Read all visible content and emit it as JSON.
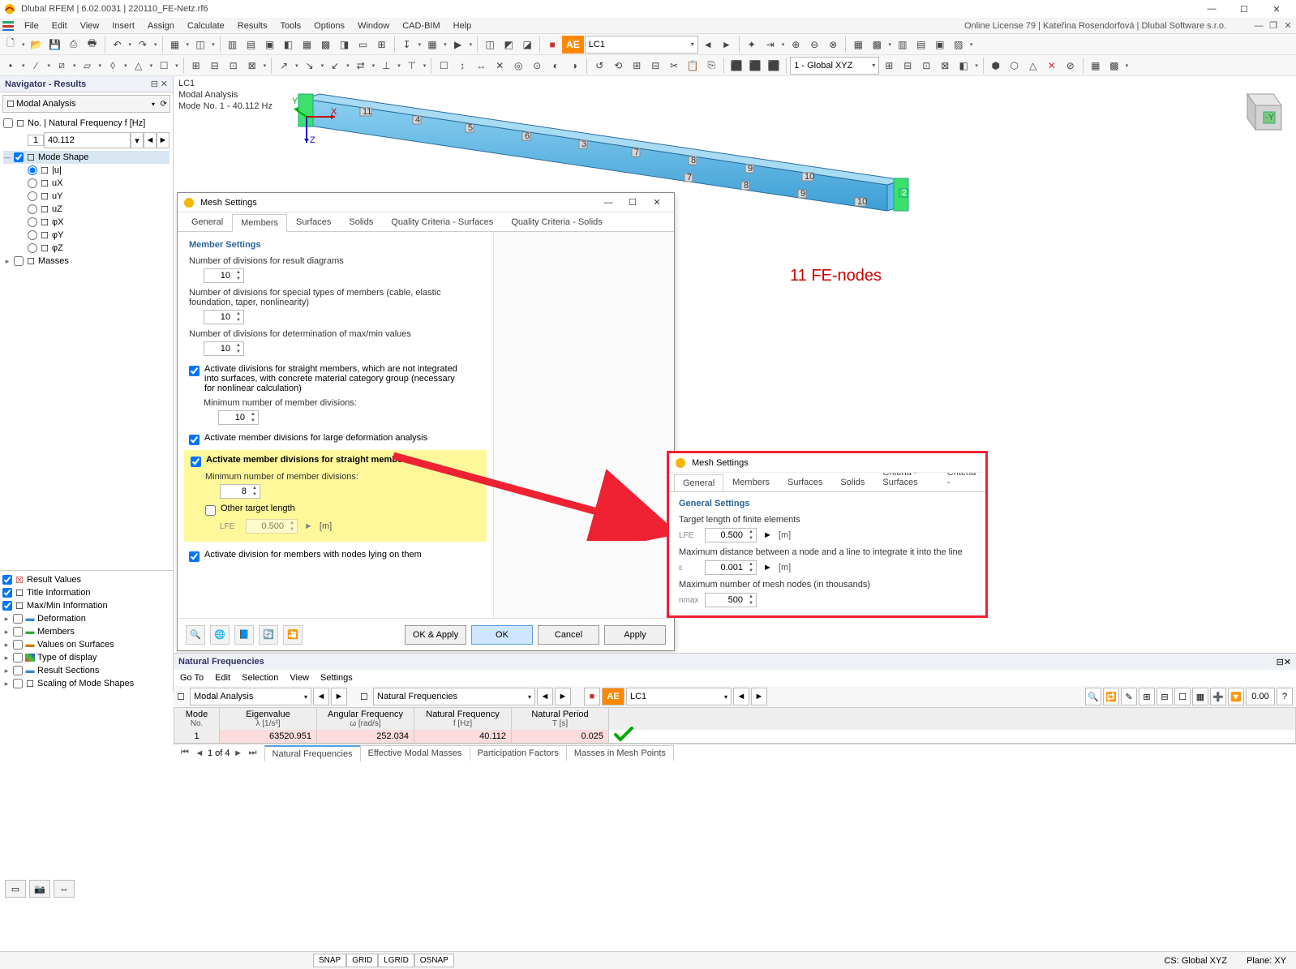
{
  "window": {
    "title": "Dlubal RFEM | 6.02.0031 | 220110_FE-Netz.rf6",
    "min": "—",
    "max": "☐",
    "close": "✕"
  },
  "menu": {
    "items": [
      "File",
      "Edit",
      "View",
      "Insert",
      "Assign",
      "Calculate",
      "Results",
      "Tools",
      "Options",
      "Window",
      "CAD-BIM",
      "Help"
    ],
    "right": "Online License 79 | Kateřina Rosendorfová | Dlubal Software s.r.o."
  },
  "toolbar1": {
    "lc_dropdown": "LC1",
    "cs_dropdown": "1 - Global XYZ"
  },
  "navigator": {
    "title": "Navigator - Results",
    "combo": "Modal Analysis",
    "row1_label": "No. | Natural Frequency f [Hz]",
    "row1_no": "1",
    "row1_val": "40.112",
    "mode_shape": "Mode Shape",
    "opts": [
      "|u|",
      "uX",
      "uY",
      "uZ",
      "φX",
      "φY",
      "φZ"
    ],
    "masses": "Masses",
    "bottom": [
      "Result Values",
      "Title Information",
      "Max/Min Information",
      "Deformation",
      "Members",
      "Values on Surfaces",
      "Type of display",
      "Result Sections",
      "Scaling of Mode Shapes"
    ]
  },
  "viewport": {
    "line1": "LC1",
    "line2": "Modal Analysis",
    "line3": "Mode No. 1 - 40.112 Hz",
    "annotation": "11 FE-nodes"
  },
  "mesh_dialog": {
    "title": "Mesh Settings",
    "tabs": [
      "General",
      "Members",
      "Surfaces",
      "Solids",
      "Quality Criteria - Surfaces",
      "Quality Criteria - Solids"
    ],
    "section": "Member Settings",
    "l1": "Number of divisions for result diagrams",
    "v1": "10",
    "l2": "Number of divisions for special types of members (cable, elastic foundation, taper, nonlinearity)",
    "v2": "10",
    "l3": "Number of divisions for determination of max/min values",
    "v3": "10",
    "c1": "Activate divisions for straight members, which are not integrated into surfaces, with concrete material category group (necessary for nonlinear calculation)",
    "c1a": "Minimum number of member divisions:",
    "c1v": "10",
    "c2": "Activate member divisions for large deformation analysis",
    "c3": "Activate member divisions for straight members",
    "c3a": "Minimum number of member divisions:",
    "c3v": "8",
    "c3b": "Other target length",
    "c3b_lbl": "LFE",
    "c3b_val": "0.500",
    "c3b_unit": "[m]",
    "c4": "Activate division for members with nodes lying on them",
    "btn_okapply": "OK & Apply",
    "btn_ok": "OK",
    "btn_cancel": "Cancel",
    "btn_apply": "Apply"
  },
  "mesh_dialog2": {
    "title": "Mesh Settings",
    "tabs": [
      "General",
      "Members",
      "Surfaces",
      "Solids",
      "Quality Criteria - Surfaces",
      "Quality Criteria -"
    ],
    "section": "General Settings",
    "l1": "Target length of finite elements",
    "l1_lbl": "LFE",
    "l1_val": "0.500",
    "l1_unit": "[m]",
    "l2": "Maximum distance between a node and a line to integrate it into the line",
    "l2_lbl": "ε",
    "l2_val": "0.001",
    "l2_unit": "[m]",
    "l3": "Maximum number of mesh nodes (in thousands)",
    "l3_lbl": "nmax",
    "l3_val": "500"
  },
  "nf": {
    "title": "Natural Frequencies",
    "menu": [
      "Go To",
      "Edit",
      "Selection",
      "View",
      "Settings"
    ],
    "combo1": "Modal Analysis",
    "combo2": "Natural Frequencies",
    "combo3": "LC1",
    "headers": {
      "c0": "Mode",
      "c0s": "No.",
      "c1": "Eigenvalue",
      "c1s": "λ [1/s²]",
      "c2": "Angular Frequency",
      "c2s": "ω [rad/s]",
      "c3": "Natural Frequency",
      "c3s": "f [Hz]",
      "c4": "Natural Period",
      "c4s": "T [s]"
    },
    "row": {
      "no": "1",
      "ev": "63520.951",
      "af": "252.034",
      "nf": "40.112",
      "np": "0.025"
    },
    "page": "1 of 4",
    "tabs": [
      "Natural Frequencies",
      "Effective Modal Masses",
      "Participation Factors",
      "Masses in Mesh Points"
    ]
  },
  "status": {
    "snap": "SNAP",
    "grid": "GRID",
    "lgrid": "LGRID",
    "osnap": "OSNAP",
    "cs": "CS: Global XYZ",
    "plane": "Plane: XY"
  }
}
